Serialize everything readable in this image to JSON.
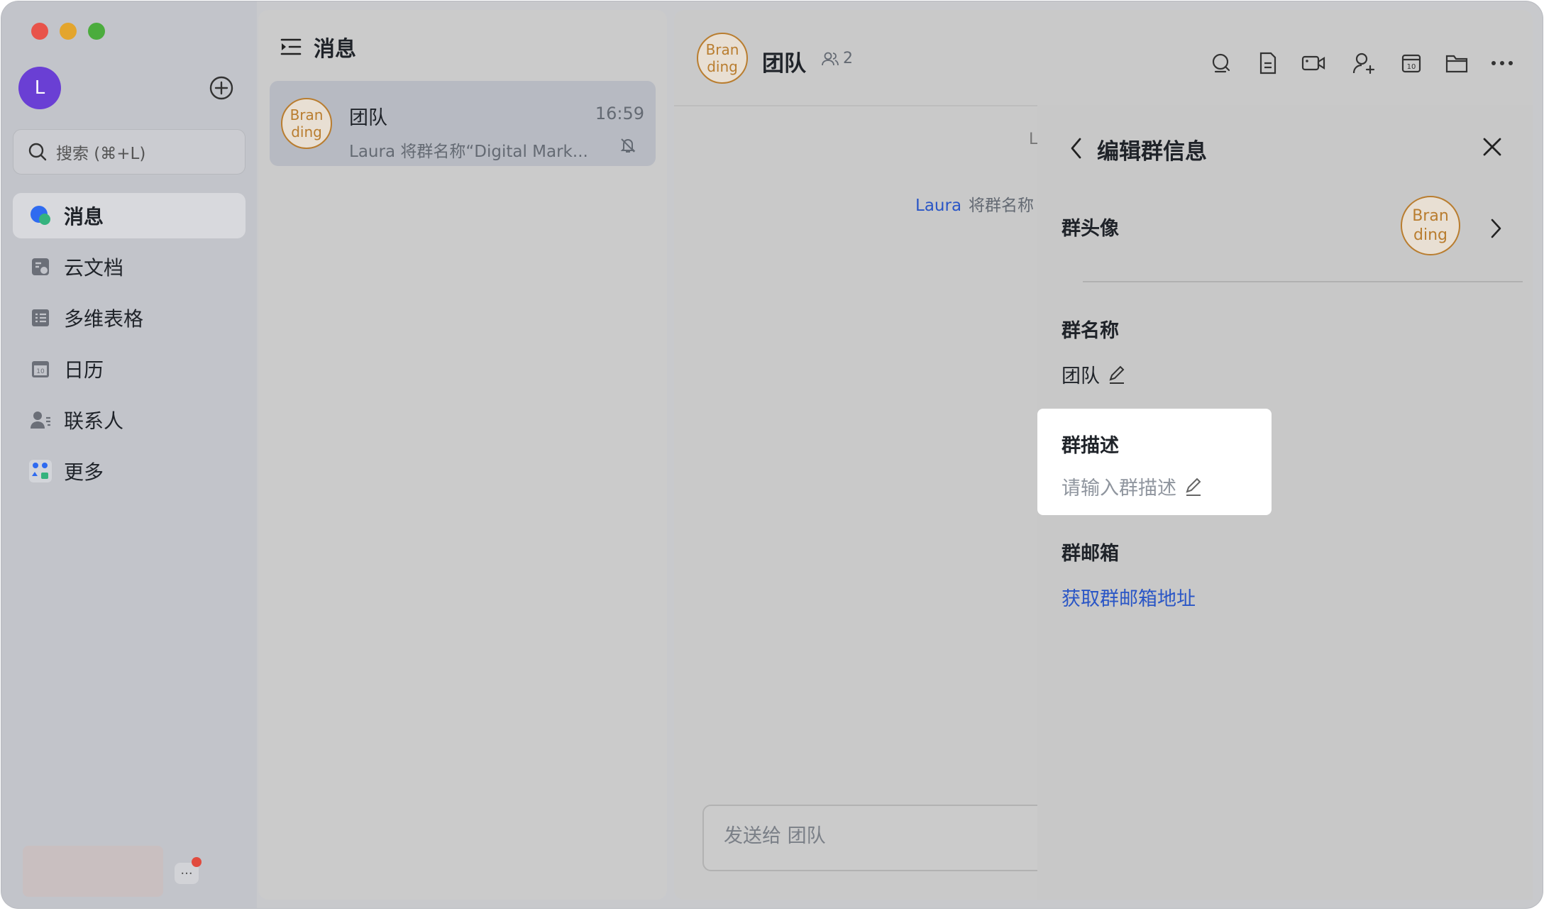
{
  "sidebar": {
    "avatar_letter": "L",
    "search_placeholder": "搜索 (⌘+L)",
    "nav": [
      {
        "label": "消息",
        "icon": "message-icon",
        "active": true
      },
      {
        "label": "云文档",
        "icon": "cloud-doc-icon"
      },
      {
        "label": "多维表格",
        "icon": "bitable-icon"
      },
      {
        "label": "日历",
        "icon": "calendar-icon"
      },
      {
        "label": "联系人",
        "icon": "contacts-icon"
      },
      {
        "label": "更多",
        "icon": "more-apps-icon"
      }
    ],
    "more_glyph": "···"
  },
  "chat_list": {
    "title": "消息",
    "items": [
      {
        "avatar_line1": "Bran",
        "avatar_line2": "ding",
        "name": "团队",
        "time": "16:59",
        "preview": "Laura 将群名称“Digital Mark..."
      }
    ]
  },
  "chat": {
    "avatar_line1": "Bran",
    "avatar_line2": "ding",
    "title": "团队",
    "member_count": "2",
    "truncated_letter": "L",
    "system_message_user": "Laura",
    "system_message_text": "将群名称",
    "composer_placeholder": "发送给 团队",
    "header_icons": [
      "search-chat-icon",
      "doc-icon",
      "video-call-icon",
      "add-member-icon",
      "calendar-icon",
      "folder-icon",
      "more-icon"
    ]
  },
  "edit_panel": {
    "title": "编辑群信息",
    "avatar_label": "群头像",
    "avatar_line1": "Bran",
    "avatar_line2": "ding",
    "name_label": "群名称",
    "name_value": "团队",
    "desc_label": "群描述",
    "desc_placeholder": "请输入群描述",
    "mail_label": "群邮箱",
    "mail_link": "获取群邮箱地址"
  },
  "colors": {
    "accent_link": "#2a56c6",
    "brand_avatar": "#b97d2f",
    "user_avatar": "#6a3fd4",
    "close_red": "#e8534a",
    "minimize_yellow": "#e3a52d",
    "zoom_green": "#4bac3d"
  }
}
